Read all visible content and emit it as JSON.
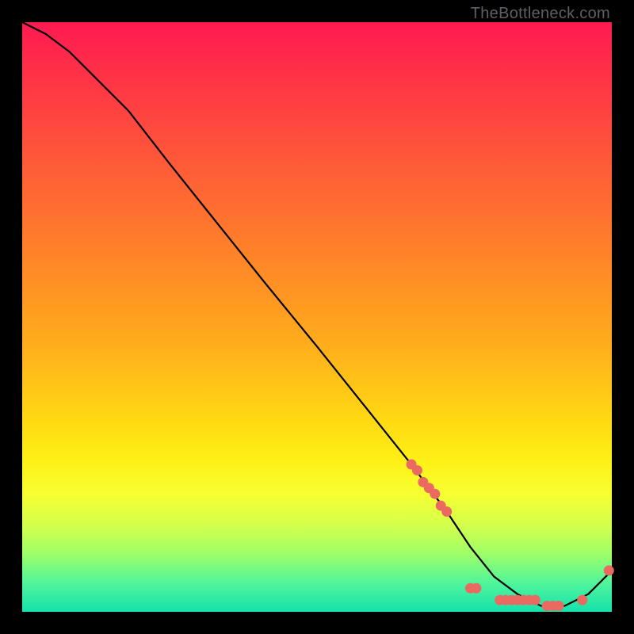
{
  "watermark": "TheBottleneck.com",
  "chart_data": {
    "type": "line",
    "title": "",
    "xlabel": "",
    "ylabel": "",
    "xlim": [
      0,
      100
    ],
    "ylim": [
      0,
      100
    ],
    "series": [
      {
        "name": "curve",
        "x": [
          0,
          4,
          8,
          12,
          18,
          25,
          33,
          41,
          50,
          58,
          66,
          72,
          76,
          80,
          84,
          88,
          92,
          96,
          100
        ],
        "y": [
          100,
          98,
          95,
          91,
          85,
          76,
          66,
          56,
          45,
          35,
          25,
          17,
          11,
          6,
          3,
          1,
          1,
          3,
          7
        ]
      }
    ],
    "points": {
      "name": "dots",
      "color": "#ea6a62",
      "x": [
        66,
        67,
        68,
        69,
        70,
        71,
        72,
        76,
        77,
        81,
        82,
        83,
        84,
        85,
        86,
        87,
        89,
        90,
        91,
        95,
        99.5
      ],
      "y": [
        25,
        24,
        22,
        21,
        20,
        18,
        17,
        4,
        4,
        2,
        2,
        2,
        2,
        2,
        2,
        2,
        1,
        1,
        1,
        2,
        7
      ]
    }
  }
}
